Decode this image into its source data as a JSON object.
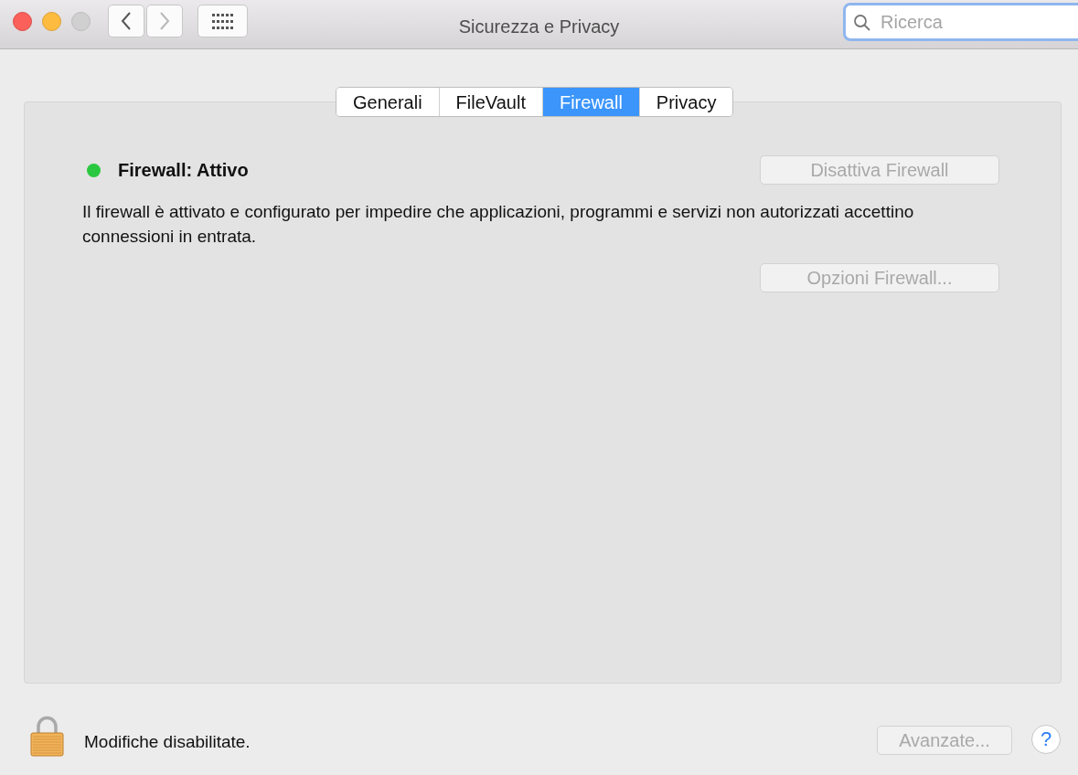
{
  "window": {
    "title": "Sicurezza e Privacy"
  },
  "navigation": [
    {
      "kind": "back",
      "disabled": false
    },
    {
      "kind": "forward",
      "disabled": true
    }
  ],
  "search": {
    "placeholder": "Ricerca"
  },
  "tabs": [
    {
      "label": "Generali",
      "selected": false
    },
    {
      "label": "FileVault",
      "selected": false
    },
    {
      "label": "Firewall",
      "selected": true
    },
    {
      "label": "Privacy",
      "selected": false
    }
  ],
  "firewall": {
    "status": "Firewall: Attivo",
    "on": true,
    "toggle_button": {
      "label": "Disattiva Firewall",
      "disabled": true
    },
    "description": "Il firewall è attivato e configurato per impedire che applicazioni, programmi e servizi non autorizzati accettino connessioni in entrata.",
    "options_button": {
      "label": "Opzioni Firewall...",
      "disabled": true
    }
  },
  "footer": {
    "locked": true,
    "lock_label": "Modifiche disabilitate.",
    "advanced_button": {
      "label": "Avanzate...",
      "disabled": true
    },
    "help": "?"
  }
}
